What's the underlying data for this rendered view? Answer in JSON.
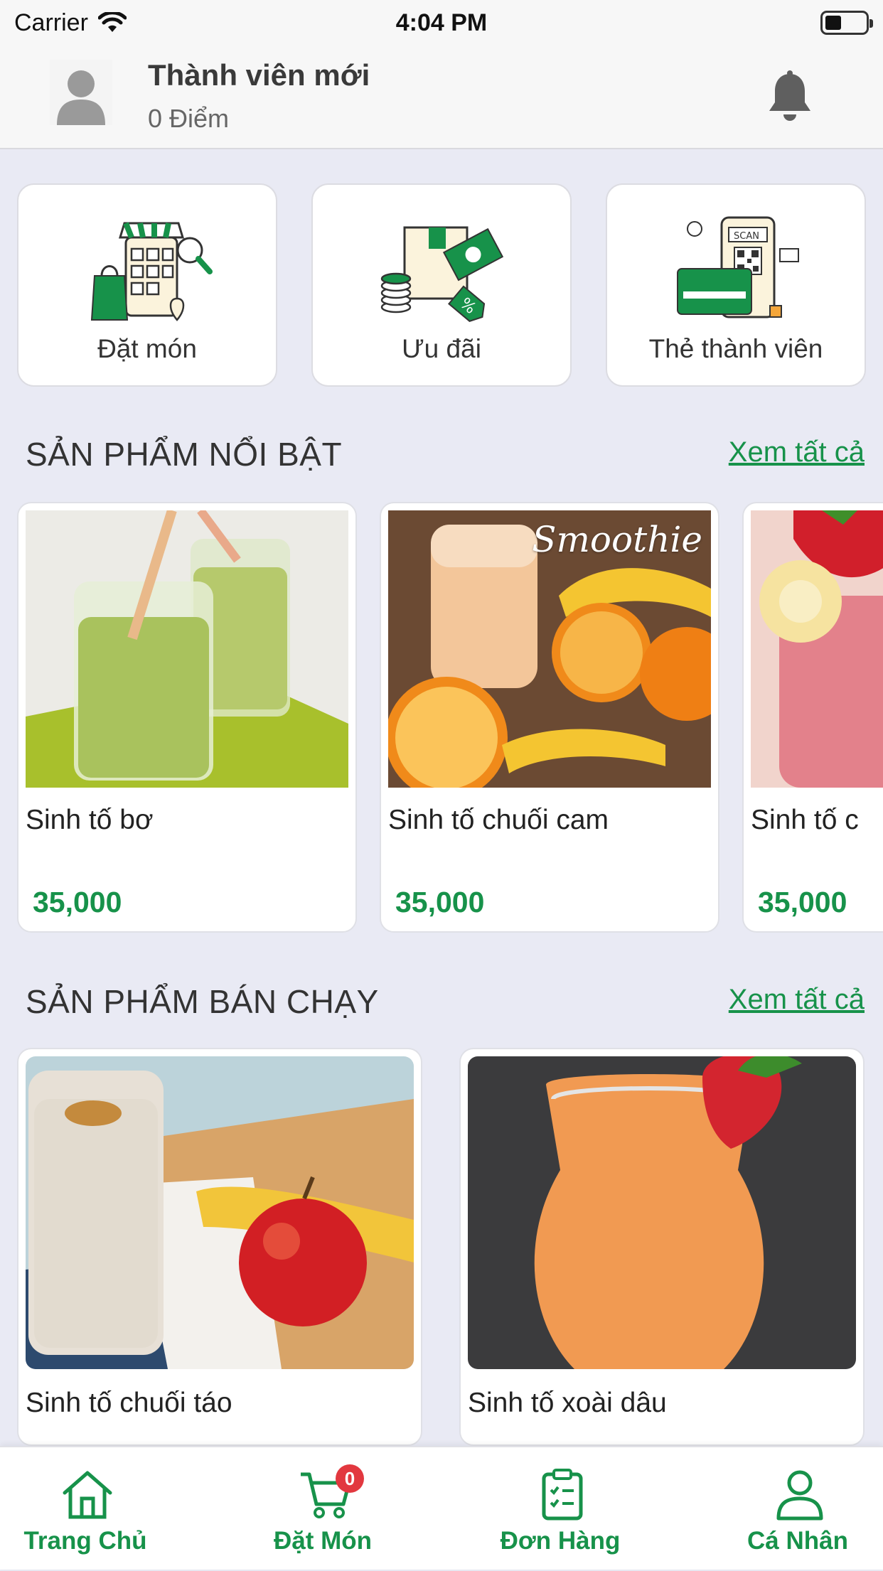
{
  "status_bar": {
    "carrier": "Carrier",
    "time": "4:04 PM"
  },
  "header": {
    "member_name": "Thành viên mới",
    "points": "0 Điểm"
  },
  "quick_actions": [
    {
      "label": "Đặt món",
      "icon": "storefront-order-icon"
    },
    {
      "label": "Ưu đãi",
      "icon": "discount-voucher-icon"
    },
    {
      "label": "Thẻ thành viên",
      "icon": "member-card-icon"
    }
  ],
  "featured": {
    "title": "SẢN PHẨM NỔI BẬT",
    "see_all": "Xem tất cả",
    "items": [
      {
        "name": "Sinh tố bơ",
        "price": "35,000"
      },
      {
        "name": "Sinh tố chuối cam",
        "price": "35,000",
        "image_text": "Smoothie"
      },
      {
        "name": "Sinh tố c",
        "price": "35,000"
      }
    ]
  },
  "bestseller": {
    "title": "SẢN PHẨM BÁN CHẠY",
    "see_all": "Xem tất cả",
    "items": [
      {
        "name": "Sinh tố chuối táo"
      },
      {
        "name": "Sinh tố xoài dâu"
      }
    ]
  },
  "tab_bar": {
    "items": [
      {
        "label": "Trang Chủ",
        "icon": "home-icon"
      },
      {
        "label": "Đặt Món",
        "icon": "cart-icon",
        "badge": "0"
      },
      {
        "label": "Đơn Hàng",
        "icon": "clipboard-icon"
      },
      {
        "label": "Cá Nhân",
        "icon": "user-icon"
      }
    ]
  },
  "colors": {
    "accent": "#17924a",
    "background": "#e9eaf4",
    "badge": "#e2383f"
  }
}
